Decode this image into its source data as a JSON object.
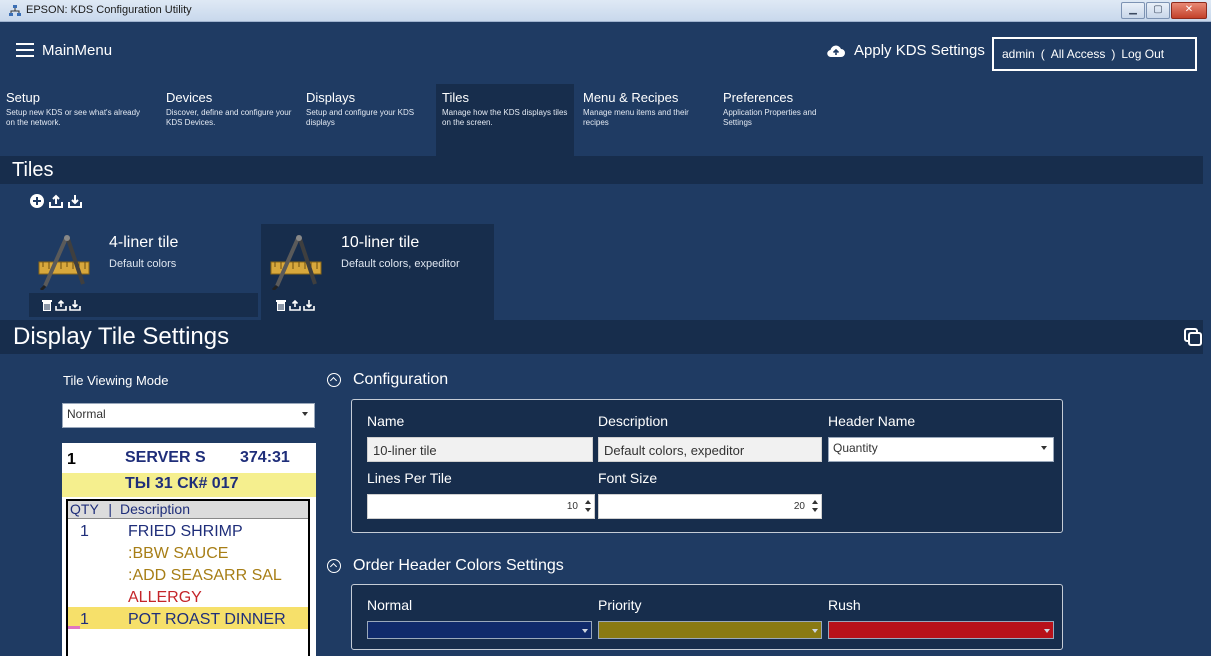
{
  "window": {
    "title": "EPSON: KDS Configuration Utility"
  },
  "topbar": {
    "menu_label": "MainMenu",
    "apply_label": "Apply KDS Settings",
    "user": "admin",
    "access_open": "(",
    "access": "All Access",
    "access_close": ")",
    "logout": "Log Out"
  },
  "nav": [
    {
      "title": "Setup",
      "desc": "Setup new KDS or see what's already on the network."
    },
    {
      "title": "Devices",
      "desc": "Discover, define and configure your KDS Devices."
    },
    {
      "title": "Displays",
      "desc": "Setup and configure your KDS displays"
    },
    {
      "title": "Tiles",
      "desc": "Manage how the KDS displays tiles on the screen."
    },
    {
      "title": "Menu & Recipes",
      "desc": "Manage menu items and their recipes"
    },
    {
      "title": "Preferences",
      "desc": "Application Properties and Settings"
    }
  ],
  "tiles_section": {
    "title": "Tiles"
  },
  "tiles": [
    {
      "name": "4-liner tile",
      "desc": "Default colors"
    },
    {
      "name": "10-liner tile",
      "desc": "Default colors, expeditor"
    }
  ],
  "display_settings": {
    "title": "Display Tile Settings",
    "viewing_mode_label": "Tile Viewing Mode",
    "viewing_mode_value": "Normal"
  },
  "preview": {
    "number": "1",
    "server": "SERVER S",
    "time": "374:31",
    "subheader": "ТЫ 31 СК# 017",
    "col_qty": "QTY",
    "col_sep": "|",
    "col_desc": "Description",
    "rows": [
      {
        "qty": "1",
        "desc": "FRIED SHRIMP"
      },
      {
        "qty": "",
        "desc": ":BBW SAUCE"
      },
      {
        "qty": "",
        "desc": ":ADD SEASARR SAL"
      },
      {
        "qty": "",
        "desc": "ALLERGY"
      },
      {
        "qty": "1",
        "desc": "POT ROAST DINNER"
      }
    ]
  },
  "configuration": {
    "title": "Configuration",
    "name_label": "Name",
    "name_value": "10-liner tile",
    "description_label": "Description",
    "description_value": "Default colors, expeditor",
    "header_name_label": "Header Name",
    "header_name_value": "Quantity",
    "lines_label": "Lines Per Tile",
    "lines_value": "10",
    "font_size_label": "Font Size",
    "font_size_value": "20"
  },
  "order_header_colors": {
    "title": "Order Header Colors Settings",
    "normal_label": "Normal",
    "normal_color": "#102a6b",
    "priority_label": "Priority",
    "priority_color": "#8a7a12",
    "rush_label": "Rush",
    "rush_color": "#b8121a"
  }
}
